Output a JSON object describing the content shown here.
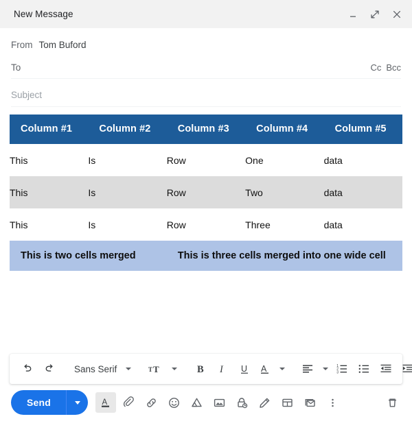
{
  "window": {
    "title": "New Message",
    "controls": [
      {
        "name": "minimize-button",
        "icon": "minimize-icon"
      },
      {
        "name": "expand-button",
        "icon": "expand-icon"
      },
      {
        "name": "close-button",
        "icon": "close-icon"
      }
    ]
  },
  "fields": {
    "from_label": "From",
    "from_value": "Tom Buford",
    "to_label": "To",
    "cc_label": "Cc",
    "bcc_label": "Bcc",
    "subject_placeholder": "Subject"
  },
  "table": {
    "headers": [
      "Column #1",
      "Column #2",
      "Column #3",
      "Column #4",
      "Column #5"
    ],
    "rows": [
      [
        "This",
        "Is",
        "Row",
        "One",
        "data"
      ],
      [
        "This",
        "Is",
        "Row",
        "Two",
        "data"
      ],
      [
        "This",
        "Is",
        "Row",
        "Three",
        "data"
      ]
    ],
    "merged_row": [
      {
        "text": "This is two cells merged",
        "colspan": 2
      },
      {
        "text": "This is three cells merged into one wide cell",
        "colspan": 3
      }
    ],
    "header_bg": "#1d5c99",
    "header_text_color": "#ffffff",
    "zebra_bg": "#dcdcdc",
    "merged_bg": "#aec3e6"
  },
  "format_toolbar": {
    "undo": "undo-icon",
    "redo": "redo-icon",
    "font_family": "Sans Serif",
    "font_size": "font-size-icon",
    "bold": "B",
    "italic": "I",
    "underline": "U",
    "text_color": "A",
    "align": "align-left-icon",
    "numbered_list": "numbered-list-icon",
    "bulleted_list": "bulleted-list-icon",
    "indent_less": "indent-less-icon",
    "indent_more": "indent-more-icon",
    "more": "more-formatting-icon"
  },
  "action_bar": {
    "send_label": "Send",
    "send_bg": "#1a73e8",
    "buttons": [
      {
        "name": "formatting-options-button",
        "icon": "text-format-icon"
      },
      {
        "name": "attach-files-button",
        "icon": "paperclip-icon"
      },
      {
        "name": "insert-link-button",
        "icon": "link-icon"
      },
      {
        "name": "insert-emoji-button",
        "icon": "emoji-icon"
      },
      {
        "name": "insert-drive-file-button",
        "icon": "google-drive-icon"
      },
      {
        "name": "insert-photo-button",
        "icon": "image-icon"
      },
      {
        "name": "confidential-mode-button",
        "icon": "lock-clock-icon"
      },
      {
        "name": "insert-signature-button",
        "icon": "pen-icon"
      },
      {
        "name": "insert-table-button",
        "icon": "table-icon"
      },
      {
        "name": "email-template-button",
        "icon": "envelope-icon"
      },
      {
        "name": "more-options-button",
        "icon": "more-vertical-icon"
      },
      {
        "name": "discard-draft-button",
        "icon": "trash-icon"
      }
    ]
  }
}
